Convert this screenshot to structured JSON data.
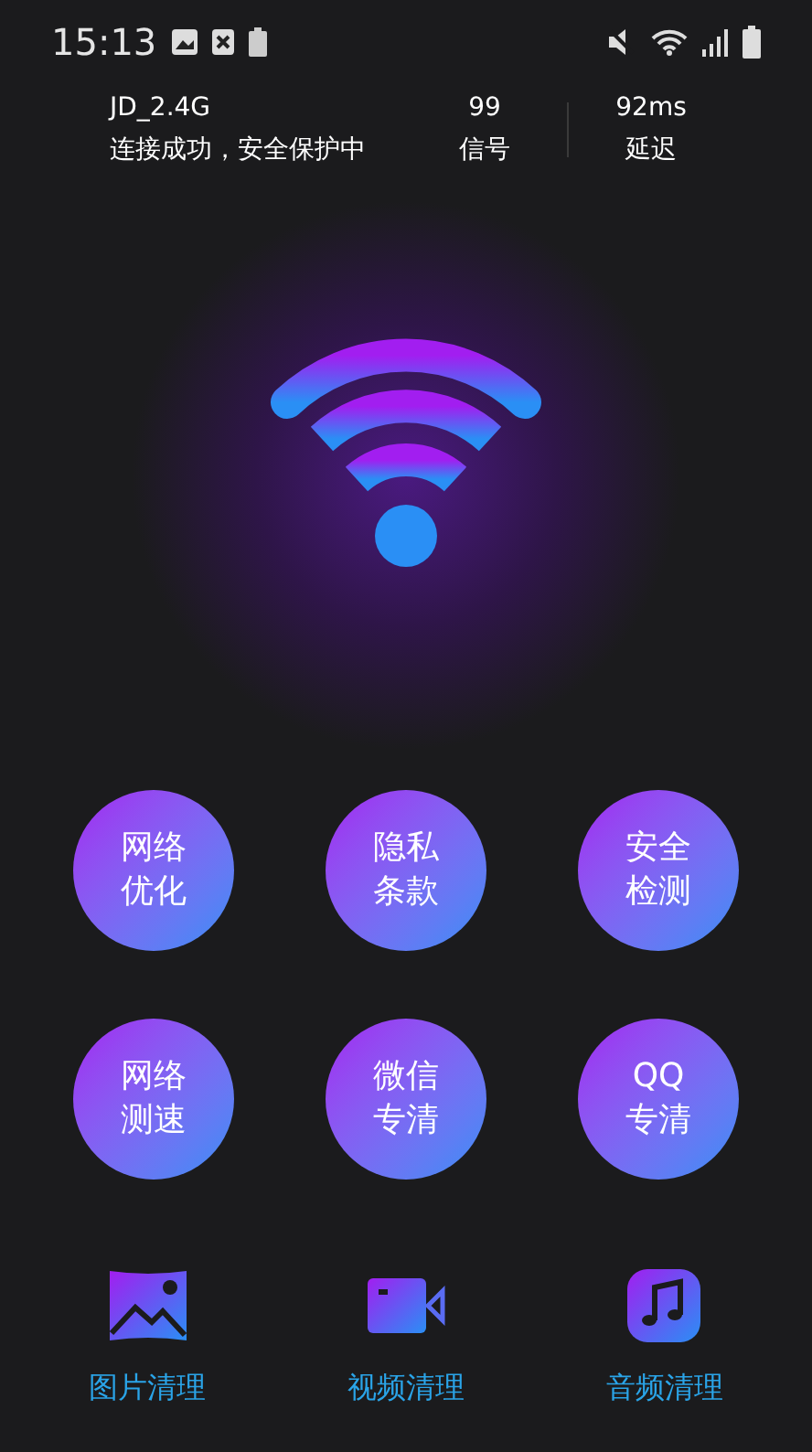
{
  "status_bar": {
    "time": "15:13"
  },
  "connection": {
    "ssid": "JD_2.4G",
    "status": "连接成功，安全保护中",
    "signal_value": "99",
    "signal_label": "信号",
    "latency_value": "92ms",
    "latency_label": "延迟"
  },
  "tools": [
    {
      "lines": [
        "网络",
        "优化"
      ]
    },
    {
      "lines": [
        "隐私",
        "条款"
      ]
    },
    {
      "lines": [
        "安全",
        "检测"
      ]
    },
    {
      "lines": [
        "网络",
        "测速"
      ]
    },
    {
      "lines": [
        "微信",
        "专清"
      ]
    },
    {
      "lines": [
        "QQ",
        "专清"
      ]
    }
  ],
  "cleaners": [
    {
      "kind": "image",
      "label": "图片清理"
    },
    {
      "kind": "video",
      "label": "视频清理"
    },
    {
      "kind": "music",
      "label": "音频清理"
    }
  ]
}
